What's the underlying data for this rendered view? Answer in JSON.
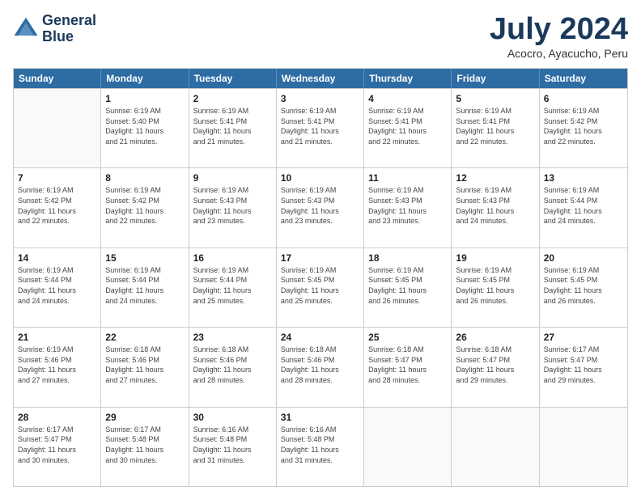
{
  "logo": {
    "line1": "General",
    "line2": "Blue"
  },
  "header": {
    "month": "July 2024",
    "location": "Acocro, Ayacucho, Peru"
  },
  "days_of_week": [
    "Sunday",
    "Monday",
    "Tuesday",
    "Wednesday",
    "Thursday",
    "Friday",
    "Saturday"
  ],
  "weeks": [
    [
      {
        "day": "",
        "sunrise": "",
        "sunset": "",
        "daylight": ""
      },
      {
        "day": "1",
        "sunrise": "Sunrise: 6:19 AM",
        "sunset": "Sunset: 5:40 PM",
        "daylight": "Daylight: 11 hours and 21 minutes."
      },
      {
        "day": "2",
        "sunrise": "Sunrise: 6:19 AM",
        "sunset": "Sunset: 5:41 PM",
        "daylight": "Daylight: 11 hours and 21 minutes."
      },
      {
        "day": "3",
        "sunrise": "Sunrise: 6:19 AM",
        "sunset": "Sunset: 5:41 PM",
        "daylight": "Daylight: 11 hours and 21 minutes."
      },
      {
        "day": "4",
        "sunrise": "Sunrise: 6:19 AM",
        "sunset": "Sunset: 5:41 PM",
        "daylight": "Daylight: 11 hours and 22 minutes."
      },
      {
        "day": "5",
        "sunrise": "Sunrise: 6:19 AM",
        "sunset": "Sunset: 5:41 PM",
        "daylight": "Daylight: 11 hours and 22 minutes."
      },
      {
        "day": "6",
        "sunrise": "Sunrise: 6:19 AM",
        "sunset": "Sunset: 5:42 PM",
        "daylight": "Daylight: 11 hours and 22 minutes."
      }
    ],
    [
      {
        "day": "7",
        "sunrise": "Sunrise: 6:19 AM",
        "sunset": "Sunset: 5:42 PM",
        "daylight": "Daylight: 11 hours and 22 minutes."
      },
      {
        "day": "8",
        "sunrise": "Sunrise: 6:19 AM",
        "sunset": "Sunset: 5:42 PM",
        "daylight": "Daylight: 11 hours and 22 minutes."
      },
      {
        "day": "9",
        "sunrise": "Sunrise: 6:19 AM",
        "sunset": "Sunset: 5:43 PM",
        "daylight": "Daylight: 11 hours and 23 minutes."
      },
      {
        "day": "10",
        "sunrise": "Sunrise: 6:19 AM",
        "sunset": "Sunset: 5:43 PM",
        "daylight": "Daylight: 11 hours and 23 minutes."
      },
      {
        "day": "11",
        "sunrise": "Sunrise: 6:19 AM",
        "sunset": "Sunset: 5:43 PM",
        "daylight": "Daylight: 11 hours and 23 minutes."
      },
      {
        "day": "12",
        "sunrise": "Sunrise: 6:19 AM",
        "sunset": "Sunset: 5:43 PM",
        "daylight": "Daylight: 11 hours and 24 minutes."
      },
      {
        "day": "13",
        "sunrise": "Sunrise: 6:19 AM",
        "sunset": "Sunset: 5:44 PM",
        "daylight": "Daylight: 11 hours and 24 minutes."
      }
    ],
    [
      {
        "day": "14",
        "sunrise": "Sunrise: 6:19 AM",
        "sunset": "Sunset: 5:44 PM",
        "daylight": "Daylight: 11 hours and 24 minutes."
      },
      {
        "day": "15",
        "sunrise": "Sunrise: 6:19 AM",
        "sunset": "Sunset: 5:44 PM",
        "daylight": "Daylight: 11 hours and 24 minutes."
      },
      {
        "day": "16",
        "sunrise": "Sunrise: 6:19 AM",
        "sunset": "Sunset: 5:44 PM",
        "daylight": "Daylight: 11 hours and 25 minutes."
      },
      {
        "day": "17",
        "sunrise": "Sunrise: 6:19 AM",
        "sunset": "Sunset: 5:45 PM",
        "daylight": "Daylight: 11 hours and 25 minutes."
      },
      {
        "day": "18",
        "sunrise": "Sunrise: 6:19 AM",
        "sunset": "Sunset: 5:45 PM",
        "daylight": "Daylight: 11 hours and 26 minutes."
      },
      {
        "day": "19",
        "sunrise": "Sunrise: 6:19 AM",
        "sunset": "Sunset: 5:45 PM",
        "daylight": "Daylight: 11 hours and 26 minutes."
      },
      {
        "day": "20",
        "sunrise": "Sunrise: 6:19 AM",
        "sunset": "Sunset: 5:45 PM",
        "daylight": "Daylight: 11 hours and 26 minutes."
      }
    ],
    [
      {
        "day": "21",
        "sunrise": "Sunrise: 6:19 AM",
        "sunset": "Sunset: 5:46 PM",
        "daylight": "Daylight: 11 hours and 27 minutes."
      },
      {
        "day": "22",
        "sunrise": "Sunrise: 6:18 AM",
        "sunset": "Sunset: 5:46 PM",
        "daylight": "Daylight: 11 hours and 27 minutes."
      },
      {
        "day": "23",
        "sunrise": "Sunrise: 6:18 AM",
        "sunset": "Sunset: 5:46 PM",
        "daylight": "Daylight: 11 hours and 28 minutes."
      },
      {
        "day": "24",
        "sunrise": "Sunrise: 6:18 AM",
        "sunset": "Sunset: 5:46 PM",
        "daylight": "Daylight: 11 hours and 28 minutes."
      },
      {
        "day": "25",
        "sunrise": "Sunrise: 6:18 AM",
        "sunset": "Sunset: 5:47 PM",
        "daylight": "Daylight: 11 hours and 28 minutes."
      },
      {
        "day": "26",
        "sunrise": "Sunrise: 6:18 AM",
        "sunset": "Sunset: 5:47 PM",
        "daylight": "Daylight: 11 hours and 29 minutes."
      },
      {
        "day": "27",
        "sunrise": "Sunrise: 6:17 AM",
        "sunset": "Sunset: 5:47 PM",
        "daylight": "Daylight: 11 hours and 29 minutes."
      }
    ],
    [
      {
        "day": "28",
        "sunrise": "Sunrise: 6:17 AM",
        "sunset": "Sunset: 5:47 PM",
        "daylight": "Daylight: 11 hours and 30 minutes."
      },
      {
        "day": "29",
        "sunrise": "Sunrise: 6:17 AM",
        "sunset": "Sunset: 5:48 PM",
        "daylight": "Daylight: 11 hours and 30 minutes."
      },
      {
        "day": "30",
        "sunrise": "Sunrise: 6:16 AM",
        "sunset": "Sunset: 5:48 PM",
        "daylight": "Daylight: 11 hours and 31 minutes."
      },
      {
        "day": "31",
        "sunrise": "Sunrise: 6:16 AM",
        "sunset": "Sunset: 5:48 PM",
        "daylight": "Daylight: 11 hours and 31 minutes."
      },
      {
        "day": "",
        "sunrise": "",
        "sunset": "",
        "daylight": ""
      },
      {
        "day": "",
        "sunrise": "",
        "sunset": "",
        "daylight": ""
      },
      {
        "day": "",
        "sunrise": "",
        "sunset": "",
        "daylight": ""
      }
    ]
  ]
}
